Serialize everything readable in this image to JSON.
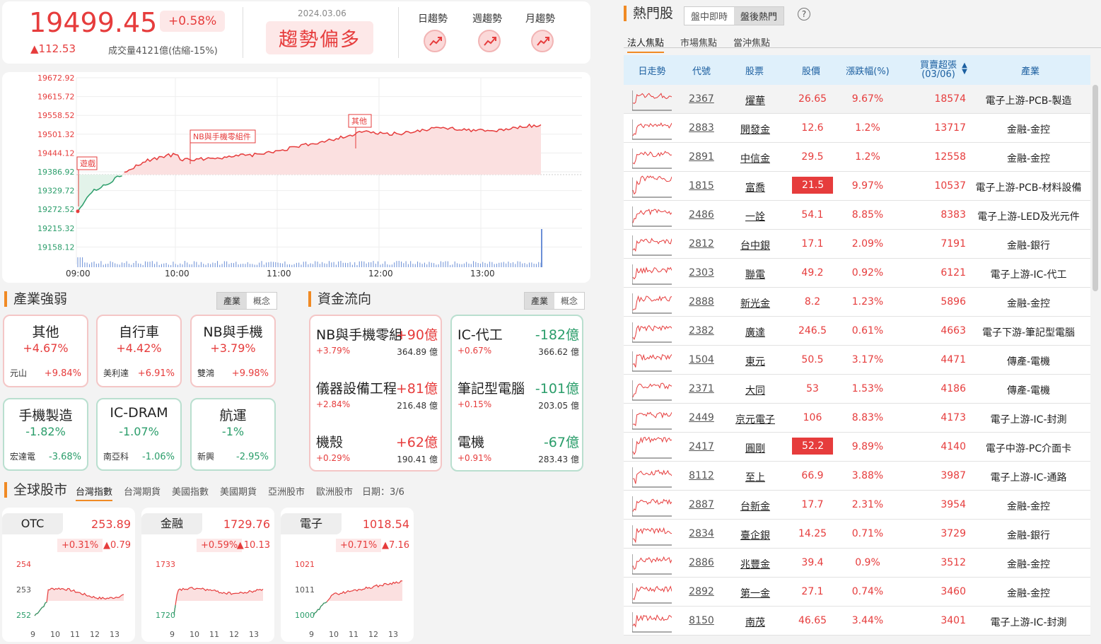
{
  "header": {
    "index_value": "19499.45",
    "index_pct": "+0.58%",
    "index_change": "▲112.53",
    "volume": "成交量4121億(估縮-15%)",
    "date": "2024.03.06",
    "trend_text": "趨勢偏多",
    "trend_tabs": [
      "日趨勢",
      "週趨勢",
      "月趨勢"
    ]
  },
  "main_chart": {
    "y_ticks": [
      "19672.92",
      "19615.72",
      "19558.52",
      "19501.32",
      "19444.12",
      "19386.92",
      "19329.72",
      "19272.52",
      "19215.32",
      "19158.12"
    ],
    "x_ticks": [
      "09:00",
      "10:00",
      "11:00",
      "12:00",
      "13:00"
    ],
    "annotations": [
      "遊戲",
      "NB與手機零組件",
      "其他"
    ]
  },
  "industry": {
    "title": "產業強弱",
    "toggle": [
      "產業",
      "概念"
    ],
    "items": [
      {
        "name": "其他",
        "pct": "+4.67%",
        "stock": "元山",
        "spct": "+9.84%",
        "up": true
      },
      {
        "name": "自行車",
        "pct": "+4.42%",
        "stock": "美利達",
        "spct": "+6.91%",
        "up": true
      },
      {
        "name": "NB與手機",
        "pct": "+3.79%",
        "stock": "雙鴻",
        "spct": "+9.98%",
        "up": true
      },
      {
        "name": "手機製造",
        "pct": "-1.82%",
        "stock": "宏達電",
        "spct": "-3.68%",
        "up": false
      },
      {
        "name": "IC-DRAM",
        "pct": "-1.07%",
        "stock": "南亞科",
        "spct": "-1.06%",
        "up": false
      },
      {
        "name": "航運",
        "pct": "-1%",
        "stock": "新興",
        "spct": "-2.95%",
        "up": false
      }
    ]
  },
  "fund_flow": {
    "title": "資金流向",
    "toggle": [
      "產業",
      "概念"
    ],
    "in": [
      {
        "name": "NB與手機零組件",
        "amt": "+90億",
        "pct": "+3.79%",
        "val": "364.89 億"
      },
      {
        "name": "儀器設備工程",
        "amt": "+81億",
        "pct": "+2.84%",
        "val": "216.48 億"
      },
      {
        "name": "機殼",
        "amt": "+62億",
        "pct": "+0.29%",
        "val": "190.41 億"
      }
    ],
    "out": [
      {
        "name": "IC-代工",
        "amt": "-182億",
        "pct": "+0.67%",
        "val": "366.62 億"
      },
      {
        "name": "筆記型電腦",
        "amt": "-101億",
        "pct": "+0.15%",
        "val": "203.05 億"
      },
      {
        "name": "電機",
        "amt": "-67億",
        "pct": "+0.91%",
        "val": "283.43 億"
      }
    ]
  },
  "global": {
    "title": "全球股市",
    "tabs": [
      "台灣指數",
      "台灣期貨",
      "美國指數",
      "美國期貨",
      "亞洲股市",
      "歐洲股市"
    ],
    "date": "日期：3/6",
    "cards": [
      {
        "name": "OTC",
        "value": "253.89",
        "pct": "+0.31%",
        "chg": "▲0.79",
        "y": [
          "254",
          "253",
          "252"
        ],
        "x": [
          "9",
          "10",
          "11",
          "12",
          "13"
        ]
      },
      {
        "name": "金融",
        "value": "1729.76",
        "pct": "+0.59%",
        "chg": "▲10.13",
        "y": [
          "1733",
          "1720"
        ],
        "x": [
          "9",
          "10",
          "11",
          "12",
          "13"
        ]
      },
      {
        "name": "電子",
        "value": "1018.54",
        "pct": "+0.71%",
        "chg": "▲7.16",
        "y": [
          "1021",
          "1011",
          "1000"
        ],
        "x": [
          "9",
          "10",
          "11",
          "12",
          "13"
        ]
      }
    ]
  },
  "hot": {
    "title": "熱門股",
    "mode_tabs": [
      "盤中即時",
      "盤後熱門"
    ],
    "help": "?",
    "tabs": [
      "法人焦點",
      "市場焦點",
      "當沖焦點"
    ],
    "columns": [
      "日走勢",
      "代號",
      "股票",
      "股價",
      "漲跌幅(%)",
      "買賣超張",
      "(03/06)",
      "產業"
    ],
    "rows": [
      {
        "code": "2367",
        "name": "燿華",
        "price": "26.65",
        "chg": "9.67%",
        "vol": "18574",
        "ind": "電子上游-PCB-製造",
        "hl": false
      },
      {
        "code": "2883",
        "name": "開發金",
        "price": "12.6",
        "chg": "1.2%",
        "vol": "13717",
        "ind": "金融-金控",
        "hl": false
      },
      {
        "code": "2891",
        "name": "中信金",
        "price": "29.5",
        "chg": "1.2%",
        "vol": "12558",
        "ind": "金融-金控",
        "hl": false
      },
      {
        "code": "1815",
        "name": "富喬",
        "price": "21.5",
        "chg": "9.97%",
        "vol": "10537",
        "ind": "電子上游-PCB-材料設備",
        "hl": true
      },
      {
        "code": "2486",
        "name": "一詮",
        "price": "54.1",
        "chg": "8.85%",
        "vol": "8383",
        "ind": "電子上游-LED及光元件",
        "hl": false
      },
      {
        "code": "2812",
        "name": "台中銀",
        "price": "17.1",
        "chg": "2.09%",
        "vol": "7191",
        "ind": "金融-銀行",
        "hl": false
      },
      {
        "code": "2303",
        "name": "聯電",
        "price": "49.2",
        "chg": "0.92%",
        "vol": "6121",
        "ind": "電子上游-IC-代工",
        "hl": false
      },
      {
        "code": "2888",
        "name": "新光金",
        "price": "8.2",
        "chg": "1.23%",
        "vol": "5896",
        "ind": "金融-金控",
        "hl": false
      },
      {
        "code": "2382",
        "name": "廣達",
        "price": "246.5",
        "chg": "0.61%",
        "vol": "4663",
        "ind": "電子下游-筆記型電腦",
        "hl": false
      },
      {
        "code": "1504",
        "name": "東元",
        "price": "50.5",
        "chg": "3.17%",
        "vol": "4471",
        "ind": "傳產-電機",
        "hl": false
      },
      {
        "code": "2371",
        "name": "大同",
        "price": "53",
        "chg": "1.53%",
        "vol": "4186",
        "ind": "傳產-電機",
        "hl": false
      },
      {
        "code": "2449",
        "name": "京元電子",
        "price": "106",
        "chg": "8.83%",
        "vol": "4173",
        "ind": "電子上游-IC-封測",
        "hl": false
      },
      {
        "code": "2417",
        "name": "圓剛",
        "price": "52.2",
        "chg": "9.89%",
        "vol": "4140",
        "ind": "電子中游-PC介面卡",
        "hl": true
      },
      {
        "code": "8112",
        "name": "至上",
        "price": "66.9",
        "chg": "3.88%",
        "vol": "3987",
        "ind": "電子上游-IC-通路",
        "hl": false
      },
      {
        "code": "2887",
        "name": "台新金",
        "price": "17.7",
        "chg": "2.31%",
        "vol": "3954",
        "ind": "金融-金控",
        "hl": false
      },
      {
        "code": "2834",
        "name": "臺企銀",
        "price": "14.25",
        "chg": "0.71%",
        "vol": "3729",
        "ind": "金融-銀行",
        "hl": false
      },
      {
        "code": "2886",
        "name": "兆豐金",
        "price": "39.4",
        "chg": "0.9%",
        "vol": "3512",
        "ind": "金融-金控",
        "hl": false
      },
      {
        "code": "2892",
        "name": "第一金",
        "price": "27.1",
        "chg": "0.74%",
        "vol": "3460",
        "ind": "金融-金控",
        "hl": false
      },
      {
        "code": "8150",
        "name": "南茂",
        "price": "46.65",
        "chg": "3.44%",
        "vol": "3401",
        "ind": "電子上游-IC-封測",
        "hl": false
      }
    ]
  }
}
